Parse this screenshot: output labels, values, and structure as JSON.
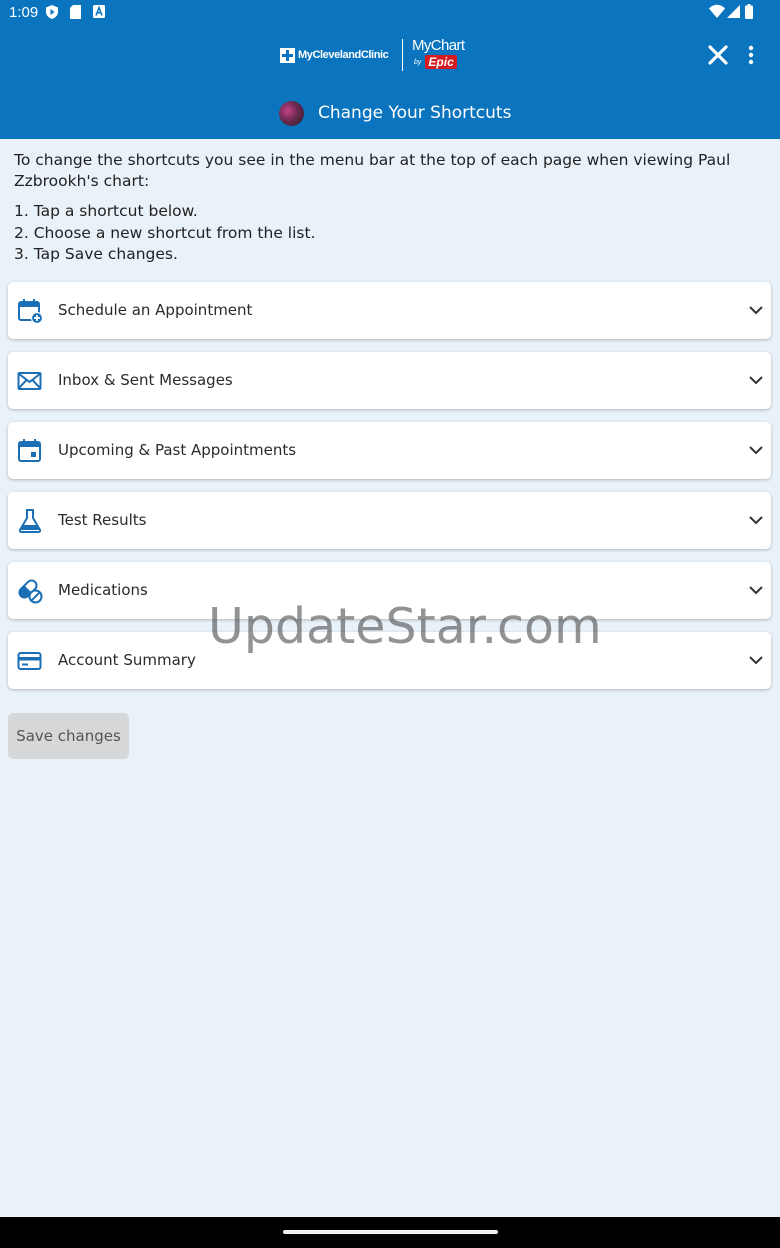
{
  "status_bar": {
    "time": "1:09"
  },
  "header": {
    "brand_left": "MyClevelandClinic",
    "brand_right": "MyChart",
    "brand_by": "by",
    "brand_epic": "Epic",
    "title": "Change Your Shortcuts"
  },
  "instructions": {
    "intro": "To change the shortcuts you see in the menu bar at the top of each page when viewing Paul Zzbrookh's chart:",
    "steps": [
      "1. Tap a shortcut below.",
      "2. Choose a new shortcut from the list.",
      "3. Tap Save changes."
    ]
  },
  "shortcuts": [
    {
      "label": "Schedule an Appointment",
      "icon": "calendar-plus-icon"
    },
    {
      "label": "Inbox & Sent Messages",
      "icon": "envelope-icon"
    },
    {
      "label": "Upcoming & Past Appointments",
      "icon": "calendar-icon"
    },
    {
      "label": "Test Results",
      "icon": "flask-icon"
    },
    {
      "label": "Medications",
      "icon": "pill-icon"
    },
    {
      "label": "Account Summary",
      "icon": "credit-card-icon"
    }
  ],
  "save_button": {
    "label": "Save changes"
  },
  "watermark": "UpdateStar.com",
  "colors": {
    "header_bg": "#0a74bf",
    "page_bg": "#eaf2f9",
    "icon_blue": "#1a6fb5",
    "button_disabled_bg": "#d5d7d9"
  }
}
